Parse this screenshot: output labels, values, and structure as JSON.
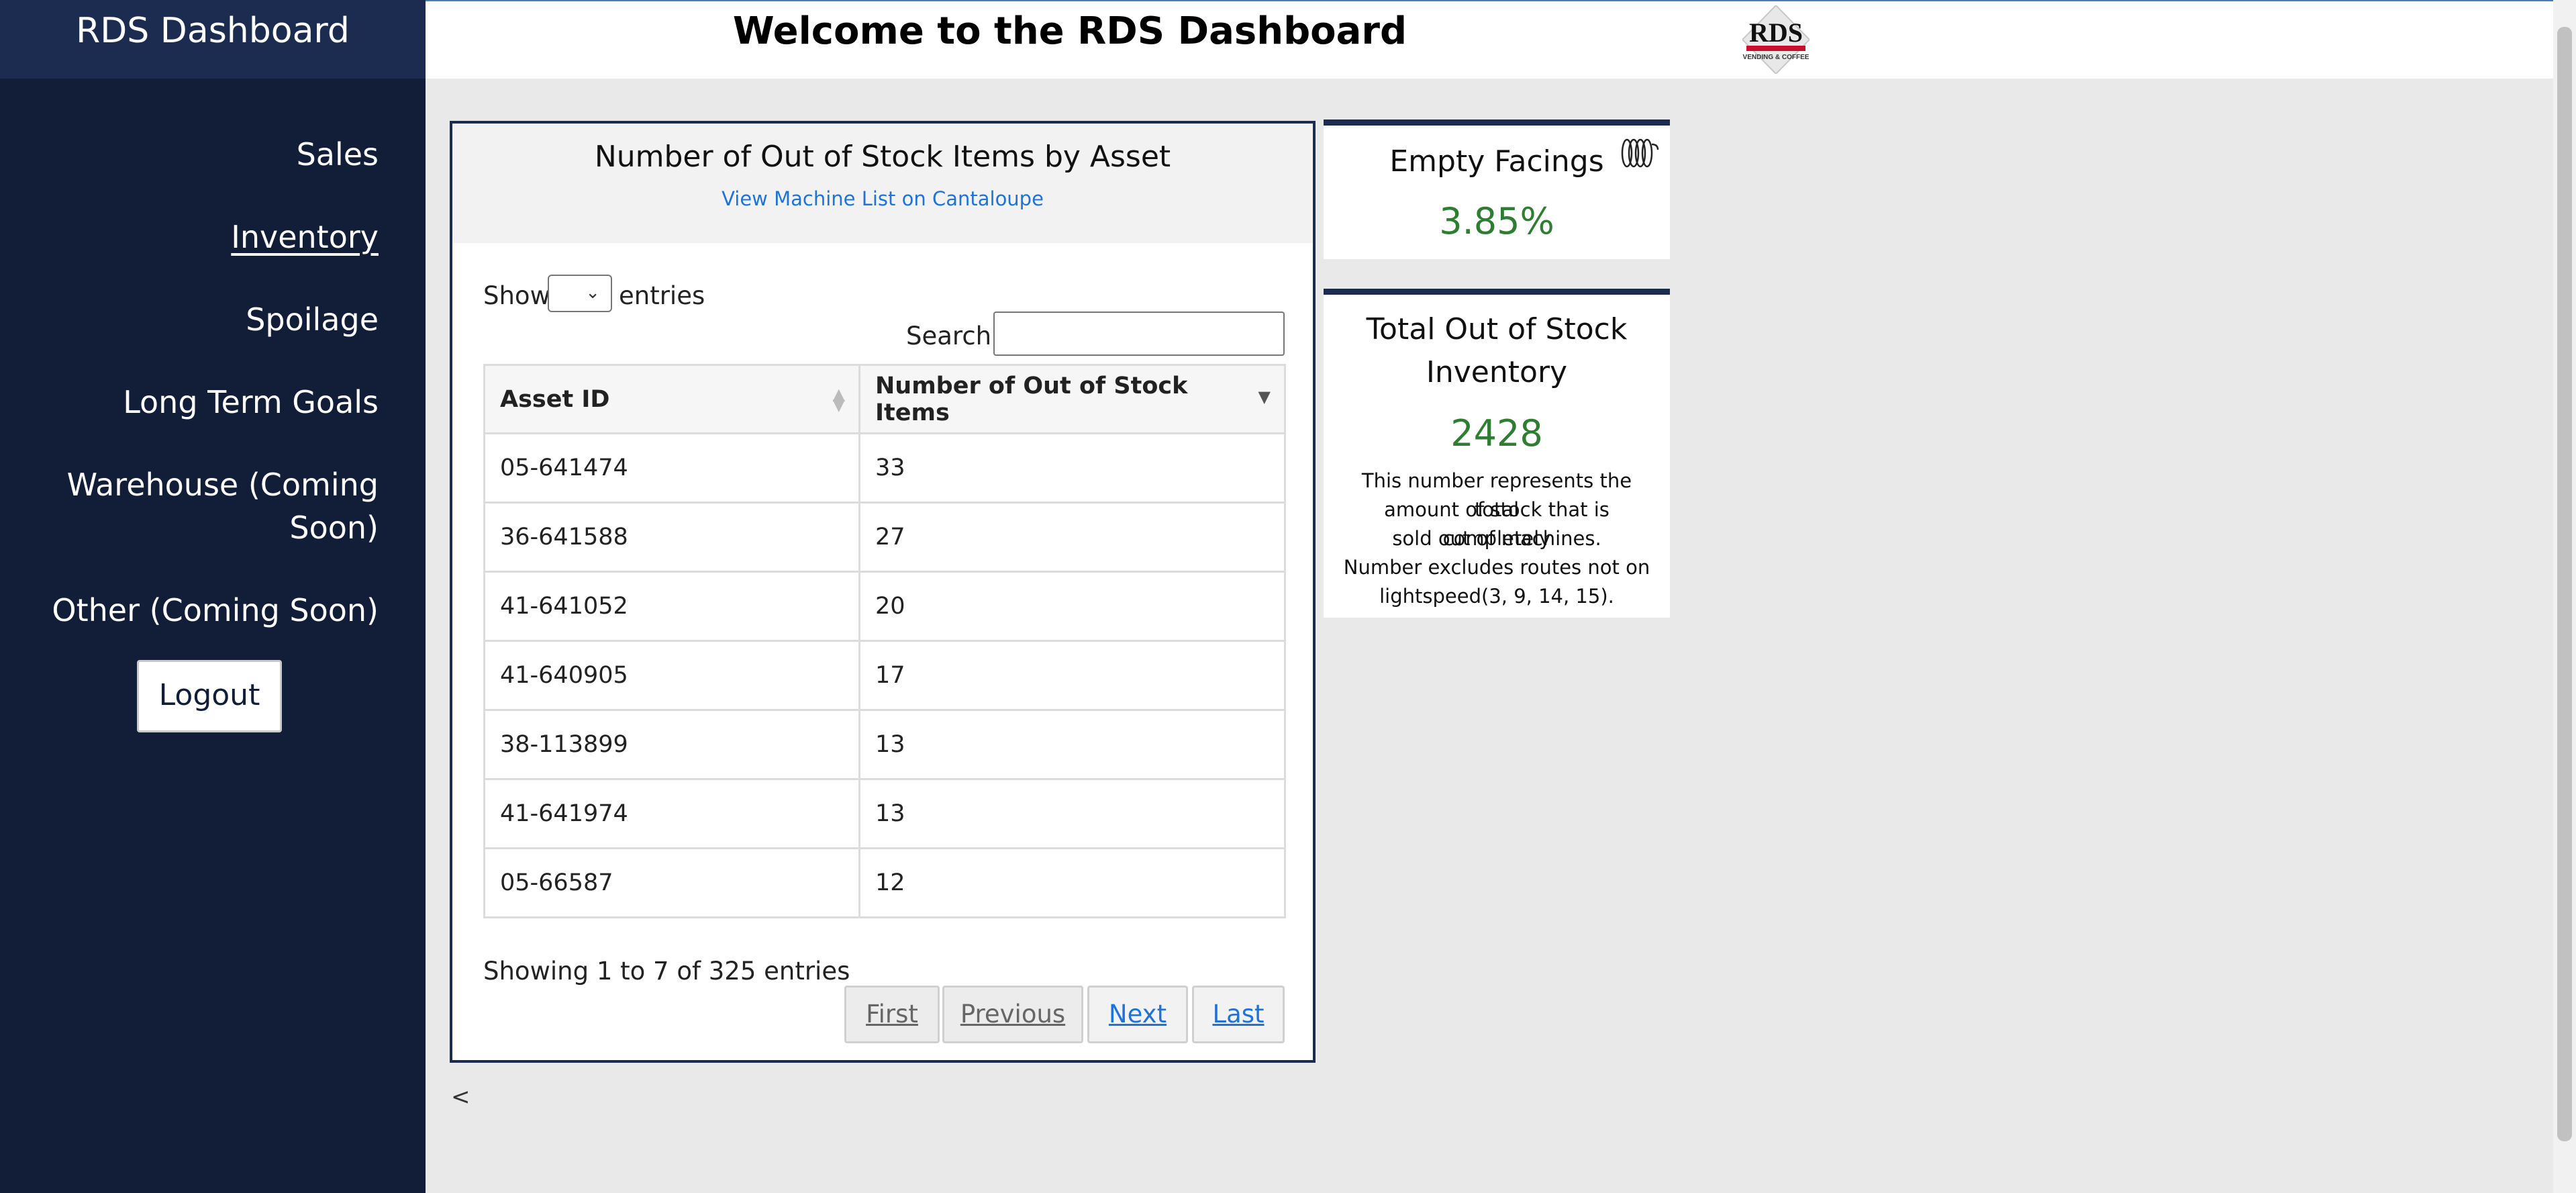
{
  "sidebar": {
    "title": "RDS Dashboard",
    "items": [
      {
        "label": "Sales"
      },
      {
        "label": "Inventory"
      },
      {
        "label": "Spoilage"
      },
      {
        "label": "Long Term Goals"
      },
      {
        "label": "Warehouse (Coming",
        "label2": "Soon)"
      },
      {
        "label": "Other (Coming Soon)"
      }
    ],
    "logout_label": "Logout"
  },
  "header": {
    "title": "Welcome to the RDS Dashboard",
    "logo_text": "RDS",
    "logo_subtext": "VENDING & COFFEE"
  },
  "table_panel": {
    "title": "Number of Out of Stock Items by Asset",
    "link": "View Machine List on Cantaloupe",
    "show_label": "Show",
    "entries_label": "entries",
    "search_label": "Search:",
    "search_value": "",
    "columns": [
      "Asset ID",
      "Number of Out of Stock Items"
    ],
    "rows": [
      [
        "05-641474",
        "33"
      ],
      [
        "36-641588",
        "27"
      ],
      [
        "41-641052",
        "20"
      ],
      [
        "41-640905",
        "17"
      ],
      [
        "38-113899",
        "13"
      ],
      [
        "41-641974",
        "13"
      ],
      [
        "05-66587",
        "12"
      ]
    ],
    "info": "Showing 1 to 7 of 325 entries",
    "pagination": [
      "First",
      "Previous",
      "Next",
      "Last"
    ],
    "back_label": "<"
  },
  "cards": {
    "empty_facings": {
      "title": "Empty Facings",
      "value": "3.85%",
      "icon": "coil-icon"
    },
    "total_out_of_stock": {
      "title_line1": "Total Out of Stock",
      "title_line2": "Inventory",
      "value": "2428",
      "desc_lines": [
        "This number represents the total",
        "amount of stock that is completely",
        "sold out of machines.",
        "Number excludes routes not on",
        "lightspeed(3, 9, 14, 15)."
      ]
    }
  },
  "colors": {
    "sidebar_bg": "#121d38",
    "sidebar_header_bg": "#1b2c50",
    "value_green": "#2e7d32",
    "link_blue": "#1f73d6",
    "logo_red": "#c8102e"
  }
}
